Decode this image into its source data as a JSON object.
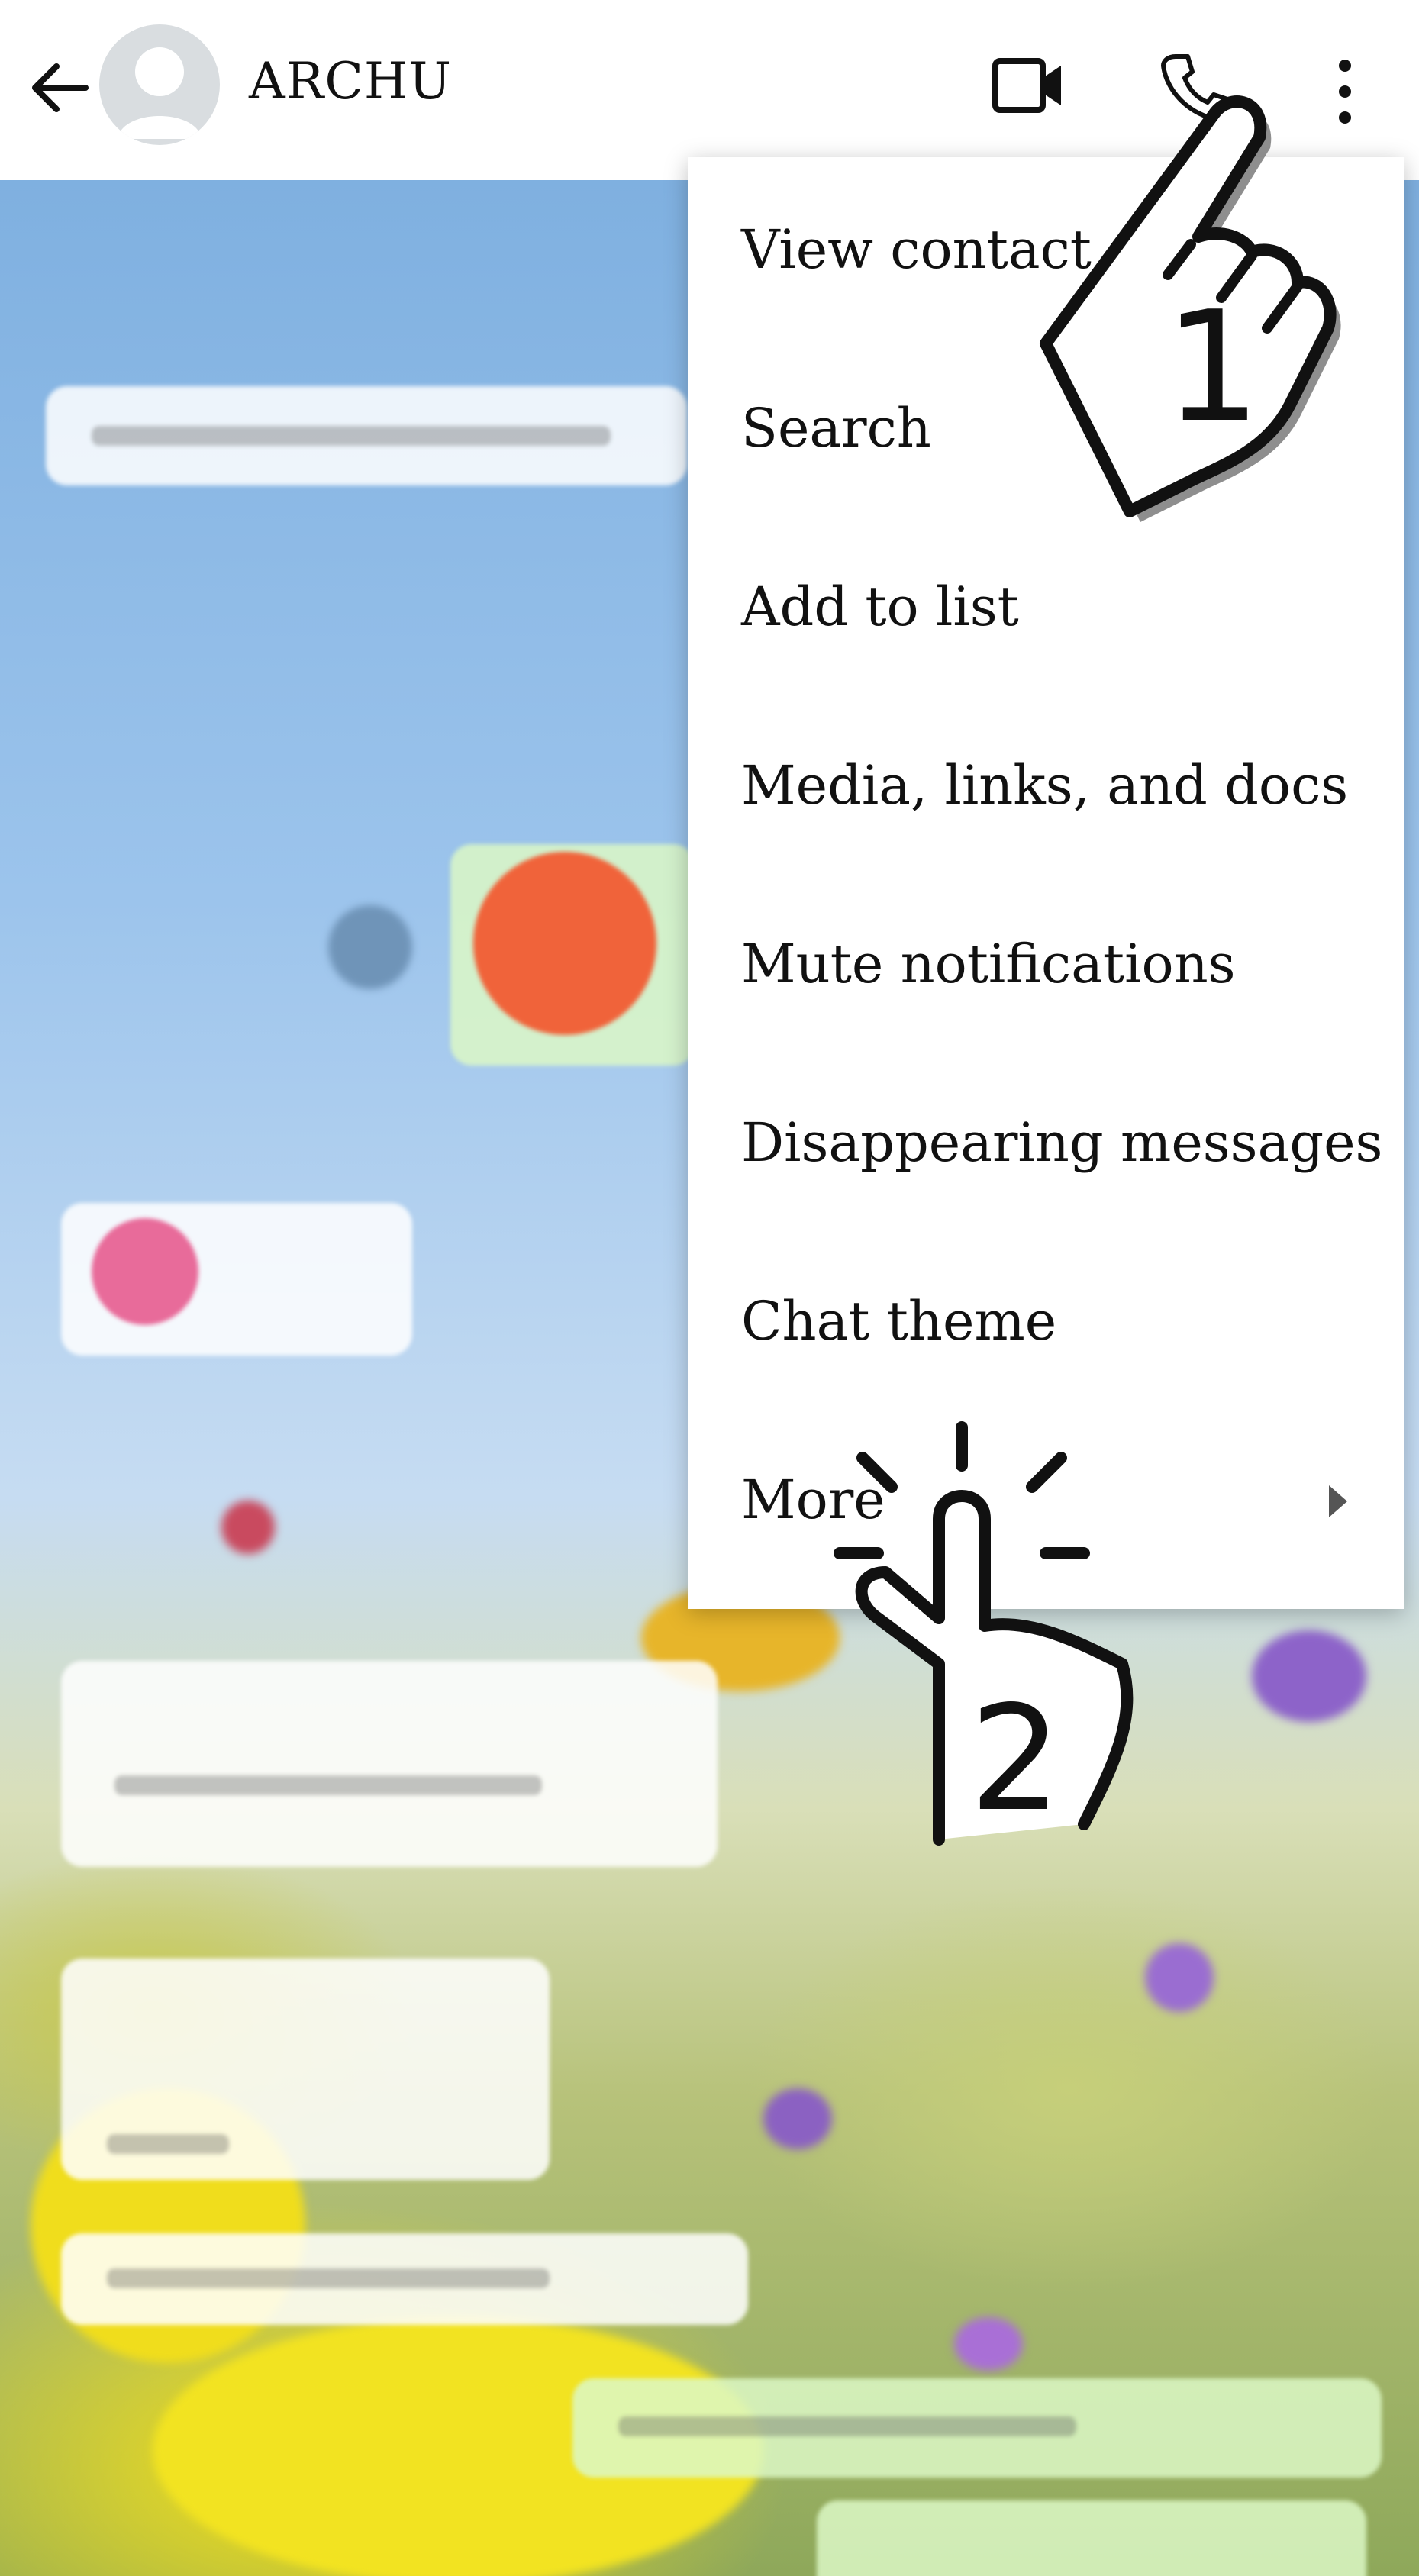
{
  "header": {
    "contact_name": "ARCHU",
    "back_icon": "back-arrow-icon",
    "avatar_icon": "default-avatar-icon",
    "actions": [
      "video-call-icon",
      "voice-call-icon",
      "more-options-icon"
    ]
  },
  "menu": {
    "items": [
      {
        "label": "View contact"
      },
      {
        "label": "Search"
      },
      {
        "label": "Add to list"
      },
      {
        "label": "Media, links, and docs"
      },
      {
        "label": "Mute notifications"
      },
      {
        "label": "Disappearing messages"
      },
      {
        "label": "Chat theme"
      },
      {
        "label": "More",
        "has_submenu": true
      }
    ]
  },
  "gestures": {
    "step1": "1",
    "step2": "2"
  },
  "colors": {
    "topbar": "#ffffff",
    "menu": "#ffffff",
    "text": "#111111",
    "incoming_bubble": "#ffffff",
    "outgoing_bubble": "#dcf8c6"
  }
}
